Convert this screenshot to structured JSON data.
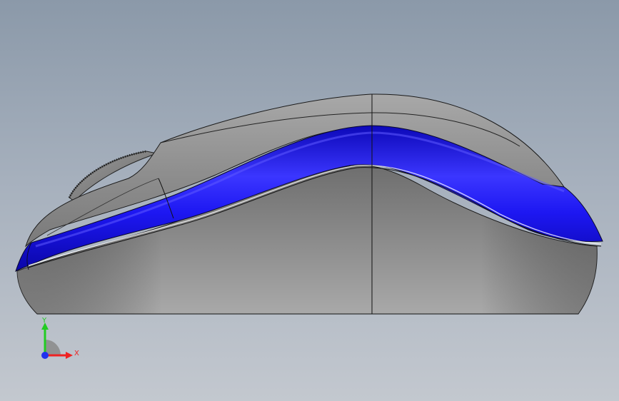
{
  "viewport": {
    "model_name": "mouse-side-view",
    "colors": {
      "background_top": "#8b99a9",
      "background_bottom": "#c3c8cf",
      "body_gray": "#8a8a8a",
      "accent_blue": "#1a14f0",
      "edge_line": "#111111"
    }
  },
  "triad": {
    "y_label": "Y",
    "x_label": "X",
    "y_color": "#22cc22",
    "x_color": "#ee2222",
    "z_color": "#2233ee"
  }
}
